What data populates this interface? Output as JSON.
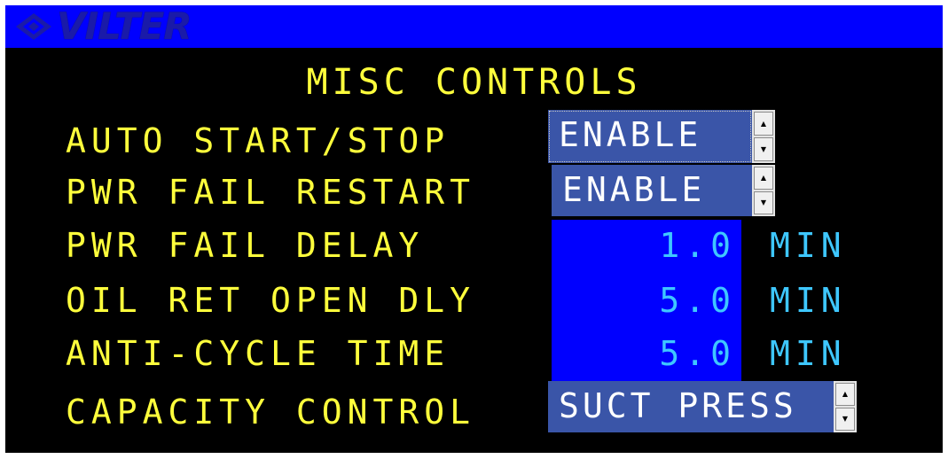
{
  "header": {
    "logo_text": "VILTER",
    "logo_icon": "vilter-diamond-logo-icon"
  },
  "screen": {
    "title": "MISC CONTROLS"
  },
  "rows": [
    {
      "label": "AUTO START/STOP",
      "value": "ENABLE"
    },
    {
      "label": "PWR FAIL RESTART",
      "value": "ENABLE"
    },
    {
      "label": "PWR FAIL DELAY",
      "value": "1.0",
      "unit": "MIN"
    },
    {
      "label": "OIL RET OPEN DLY",
      "value": "5.0",
      "unit": "MIN"
    },
    {
      "label": "ANTI-CYCLE TIME",
      "value": "5.0",
      "unit": "MIN"
    },
    {
      "label": "CAPACITY CONTROL",
      "value": "SUCT PRESS"
    }
  ],
  "colors": {
    "header_bg": "#0000ff",
    "screen_bg": "#000000",
    "label_text": "#ffff3c",
    "value_text": "#3ec7ff",
    "dropdown_bg": "#3a55a8"
  }
}
